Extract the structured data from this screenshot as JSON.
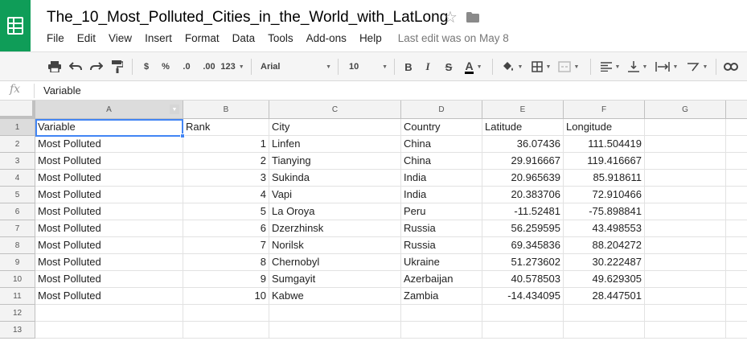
{
  "header": {
    "title": "The_10_Most_Polluted_Cities_in_the_World_with_LatLong",
    "menu": [
      "File",
      "Edit",
      "View",
      "Insert",
      "Format",
      "Data",
      "Tools",
      "Add-ons",
      "Help"
    ],
    "last_edit": "Last edit was on May 8",
    "brand_color": "#0f9d58"
  },
  "toolbar": {
    "currency": "$",
    "percent": "%",
    "decrease_decimal": ".0",
    "increase_decimal": ".00",
    "more_formats": "123",
    "font": "Arial",
    "font_size": "10",
    "bold": "B",
    "italic": "I",
    "strikethrough": "S",
    "text_color": "A"
  },
  "formula_bar": {
    "fx": "fx",
    "content": "Variable"
  },
  "columns": [
    "A",
    "B",
    "C",
    "D",
    "E",
    "F",
    "G"
  ],
  "rows": [
    "1",
    "2",
    "3",
    "4",
    "5",
    "6",
    "7",
    "8",
    "9",
    "10",
    "11",
    "12",
    "13"
  ],
  "sheet": {
    "header": [
      "Variable",
      "Rank",
      "City",
      "Country",
      "Latitude",
      "Longitude"
    ],
    "data": [
      [
        "Most Polluted",
        "1",
        "Linfen",
        "China",
        "36.07436",
        "111.504419"
      ],
      [
        "Most Polluted",
        "2",
        "Tianying",
        "China",
        "29.916667",
        "119.416667"
      ],
      [
        "Most Polluted",
        "3",
        "Sukinda",
        "India",
        "20.965639",
        "85.918611"
      ],
      [
        "Most Polluted",
        "4",
        "Vapi",
        "India",
        "20.383706",
        "72.910466"
      ],
      [
        "Most Polluted",
        "5",
        "La Oroya",
        "Peru",
        "-11.52481",
        "-75.898841"
      ],
      [
        "Most Polluted",
        "6",
        "Dzerzhinsk",
        "Russia",
        "56.259595",
        "43.498553"
      ],
      [
        "Most Polluted",
        "7",
        "Norilsk",
        "Russia",
        "69.345836",
        "88.204272"
      ],
      [
        "Most Polluted",
        "8",
        "Chernobyl",
        "Ukraine",
        "51.273602",
        "30.222487"
      ],
      [
        "Most Polluted",
        "9",
        "Sumgayit",
        "Azerbaijan",
        "40.578503",
        "49.629305"
      ],
      [
        "Most Polluted",
        "10",
        "Kabwe",
        "Zambia",
        "-14.434095",
        "28.447501"
      ]
    ]
  },
  "active_cell_color": "#4285f4"
}
